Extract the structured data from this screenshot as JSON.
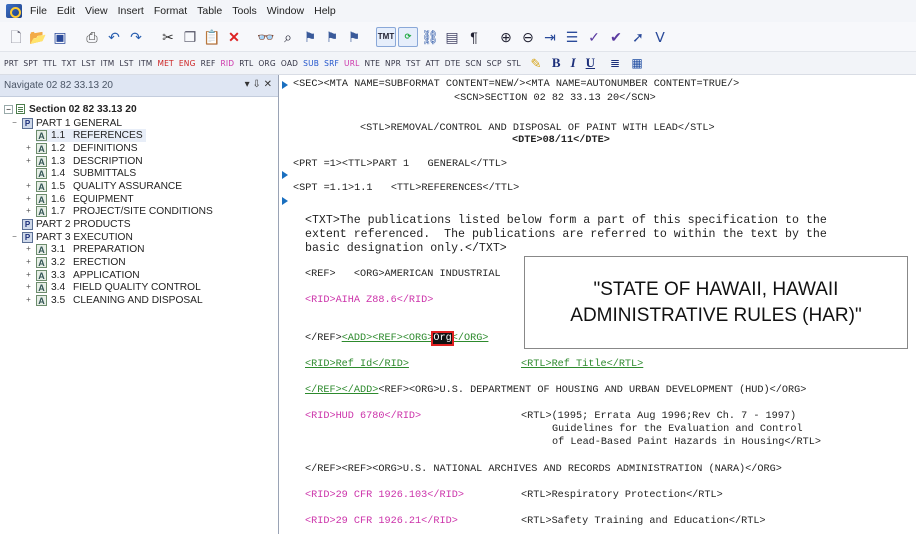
{
  "menubar": {
    "items": [
      "File",
      "Edit",
      "View",
      "Insert",
      "Format",
      "Table",
      "Tools",
      "Window",
      "Help"
    ]
  },
  "toolbar": {
    "buttons": [
      "new-icon",
      "open-icon",
      "save-icon",
      "print-icon",
      "undo-icon",
      "redo-icon",
      "cut-icon",
      "copy-icon",
      "paste-icon",
      "delete-icon",
      "find-icon",
      "find-next-icon",
      "tag1-icon",
      "tag2-icon",
      "tag3-icon",
      "tag4-icon",
      "browse-icon",
      "link-icon",
      "image-icon",
      "pilcrow-icon",
      "zoom-in-icon",
      "zoom-out-icon",
      "indent-icon",
      "list-icon",
      "spell-icon",
      "check-icon",
      "arrow-icon",
      "arrow2-icon"
    ]
  },
  "tagbar": {
    "tags": [
      {
        "label": "PRT",
        "color": "normal"
      },
      {
        "label": "SPT",
        "color": "normal"
      },
      {
        "label": "TTL",
        "color": "normal"
      },
      {
        "label": "TXT",
        "color": "normal"
      },
      {
        "label": "LST",
        "color": "normal"
      },
      {
        "label": "ITM",
        "color": "normal"
      },
      {
        "label": "LST",
        "color": "normal"
      },
      {
        "label": "ITM",
        "color": "normal"
      },
      {
        "label": "MET",
        "color": "red"
      },
      {
        "label": "ENG",
        "color": "red"
      },
      {
        "label": "REF",
        "color": "normal"
      },
      {
        "label": "RID",
        "color": "pink"
      },
      {
        "label": "RTL",
        "color": "normal"
      },
      {
        "label": "ORG",
        "color": "normal"
      },
      {
        "label": "OAD",
        "color": "normal"
      },
      {
        "label": "SUB",
        "color": "blue"
      },
      {
        "label": "SRF",
        "color": "blue"
      },
      {
        "label": "URL",
        "color": "pink"
      },
      {
        "label": "NTE",
        "color": "normal"
      },
      {
        "label": "NPR",
        "color": "normal"
      },
      {
        "label": "TST",
        "color": "normal"
      },
      {
        "label": "ATT",
        "color": "normal"
      },
      {
        "label": "DTE",
        "color": "normal"
      },
      {
        "label": "SCN",
        "color": "normal"
      },
      {
        "label": "SCP",
        "color": "normal"
      },
      {
        "label": "STL",
        "color": "normal"
      }
    ],
    "format": [
      "B",
      "I",
      "U"
    ]
  },
  "navigator": {
    "title": "Navigate 02 82 33.13 20",
    "controls": "▾ ⇩ ✕",
    "root": "Section 02 82 33.13 20",
    "part1": {
      "label": "PART 1  GENERAL"
    },
    "part1_items": [
      {
        "num": "1.1",
        "label": "REFERENCES"
      },
      {
        "num": "1.2",
        "label": "DEFINITIONS"
      },
      {
        "num": "1.3",
        "label": "DESCRIPTION"
      },
      {
        "num": "1.4",
        "label": "SUBMITTALS"
      },
      {
        "num": "1.5",
        "label": "QUALITY ASSURANCE"
      },
      {
        "num": "1.6",
        "label": "EQUIPMENT"
      },
      {
        "num": "1.7",
        "label": "PROJECT/SITE CONDITIONS"
      }
    ],
    "part2": {
      "label": "PART 2  PRODUCTS"
    },
    "part3": {
      "label": "PART 3  EXECUTION"
    },
    "part3_items": [
      {
        "num": "3.1",
        "label": "PREPARATION"
      },
      {
        "num": "3.2",
        "label": "ERECTION"
      },
      {
        "num": "3.3",
        "label": "APPLICATION"
      },
      {
        "num": "3.4",
        "label": "FIELD QUALITY CONTROL"
      },
      {
        "num": "3.5",
        "label": "CLEANING AND DISPOSAL"
      }
    ]
  },
  "editor": {
    "lines": {
      "l1": "<SEC><MTA NAME=SUBFORMAT CONTENT=NEW/><MTA NAME=AUTONUMBER CONTENT=TRUE/>",
      "l2": "<SCN>SECTION 02 82 33.13 20</SCN>",
      "l3": "<STL>REMOVAL/CONTROL AND DISPOSAL OF PAINT WITH LEAD</STL>",
      "l4": "<DTE>08/11</DTE>",
      "l5": "<PRT =1><TTL>PART 1   GENERAL</TTL>",
      "l6": "<SPT =1.1>1.1   <TTL>REFERENCES</TTL>",
      "l7a": "<TXT>The publications listed below form a part of this specification to the",
      "l7b": "extent referenced.  The publications are referred to within the text by the",
      "l7c": "basic designation only.</TXT>",
      "l8": "<REF>   <ORG>AMERICAN INDUSTRIAL",
      "l9": "<RID>AIHA Z88.6</RID>",
      "l10a": "</REF>",
      "l10b": "<ADD><REF><ORG>",
      "l10c": "Org",
      "l10d": "</ORG>",
      "l11a": "<RID>Ref Id</RID>",
      "l11b": "<RTL>Ref Title</RTL>",
      "l12a": "</REF></ADD>",
      "l12b": "<REF><ORG>U.S. DEPARTMENT OF HOUSING AND URBAN DEVELOPMENT (HUD)</ORG>",
      "l13a": "<RID>HUD 6780</RID>",
      "l13b": "<RTL>(1995; Errata Aug 1996;Rev Ch. 7 - 1997)",
      "l13c": "Guidelines for the Evaluation and Control",
      "l13d": "of Lead-Based Paint Hazards in Housing</RTL>",
      "l14": "</REF><REF><ORG>U.S. NATIONAL ARCHIVES AND RECORDS ADMINISTRATION (NARA)</ORG>",
      "l15a": "<RID>29 CFR 1926.103</RID>",
      "l15b": "<RTL>Respiratory Protection</RTL>",
      "l16a": "<RID>29 CFR 1926.21</RID>",
      "l16b": "<RTL>Safety Training and Education</RTL>"
    }
  },
  "callout": {
    "line1": "\"STATE OF HAWAII, HAWAII",
    "line2": "ADMINISTRATIVE RULES (HAR)\""
  },
  "colors": {
    "rid": "#cc33aa",
    "added": "#2d8a2d",
    "marker": "#1a6fbf"
  }
}
